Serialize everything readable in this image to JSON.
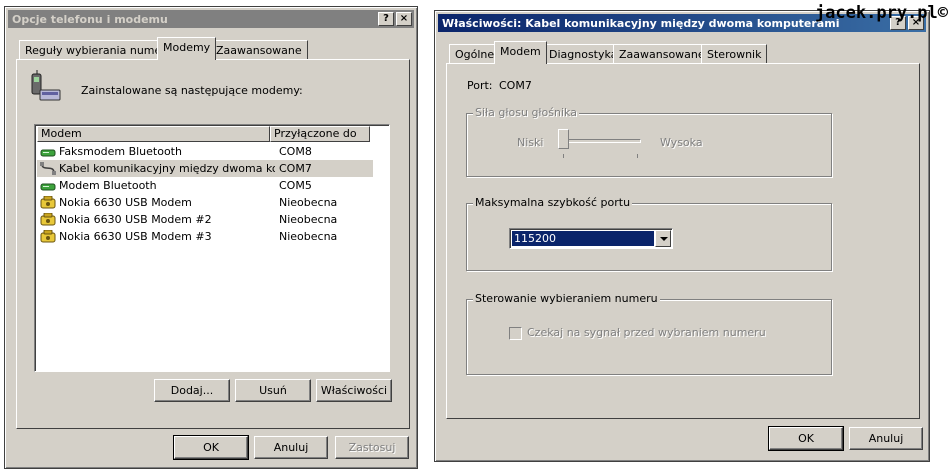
{
  "watermark": "jacek.pry.pl©",
  "left_window": {
    "title": "Opcje telefonu i modemu",
    "help_glyph": "?",
    "close_glyph": "×",
    "tabs": [
      "Reguły wybierania numeru",
      "Modemy",
      "Zaawansowane"
    ],
    "selected_tab": "Modemy",
    "intro_text": "Zainstalowane są następujące modemy:",
    "columns": [
      "Modem",
      "Przyłączone do"
    ],
    "modems": [
      {
        "name": "Faksmodem Bluetooth",
        "port": "COM8",
        "icon": "modem-green-icon"
      },
      {
        "name": "Kabel komunikacyjny między dwoma komp...",
        "port": "COM7",
        "icon": "cable-icon",
        "selected": true
      },
      {
        "name": "Modem Bluetooth",
        "port": "COM5",
        "icon": "modem-green-icon"
      },
      {
        "name": "Nokia 6630 USB Modem",
        "port": "Nieobecna",
        "icon": "phone-yellow-icon"
      },
      {
        "name": "Nokia 6630 USB Modem #2",
        "port": "Nieobecna",
        "icon": "phone-yellow-icon"
      },
      {
        "name": "Nokia 6630 USB Modem #3",
        "port": "Nieobecna",
        "icon": "phone-yellow-icon"
      }
    ],
    "buttons": {
      "add": "Dodaj...",
      "remove": "Usuń",
      "properties": "Właściwości"
    },
    "footer": {
      "ok": "OK",
      "cancel": "Anuluj",
      "apply": "Zastosuj"
    }
  },
  "right_window": {
    "title": "Właściwości: Kabel komunikacyjny między dwoma komputerami",
    "help_glyph": "?",
    "close_glyph": "×",
    "tabs": [
      "Ogólne",
      "Modem",
      "Diagnostyka",
      "Zaawansowane",
      "Sterownik"
    ],
    "selected_tab": "Modem",
    "port_label": "Port:",
    "port_value": "COM7",
    "volume_group": {
      "title": "Siła głosu głośnika",
      "low": "Niski",
      "high": "Wysoka",
      "level": 0.0
    },
    "speed_group": {
      "title": "Maksymalna szybkość portu",
      "value": "115200"
    },
    "dial_group": {
      "title": "Sterowanie wybieraniem numeru",
      "checkbox_label": "Czekaj na sygnał przed wybraniem numeru",
      "checked": false
    },
    "footer": {
      "ok": "OK",
      "cancel": "Anuluj"
    }
  }
}
